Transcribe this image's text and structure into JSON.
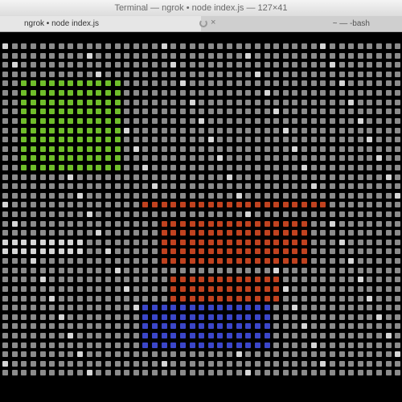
{
  "window": {
    "title": "Terminal — ngrok • node index.js — 127×41"
  },
  "tabs": [
    {
      "label": "ngrok • node index.js",
      "active": true
    },
    {
      "label": "~ — -bash",
      "active": false
    }
  ],
  "grid": {
    "columns": 43,
    "rows": 36,
    "colors": {
      "default": "#8b8b8b",
      "light": "#d6d6d6",
      "green": "#6fbe2a",
      "red": "#c0421f",
      "blue": "#3b46c9"
    }
  }
}
